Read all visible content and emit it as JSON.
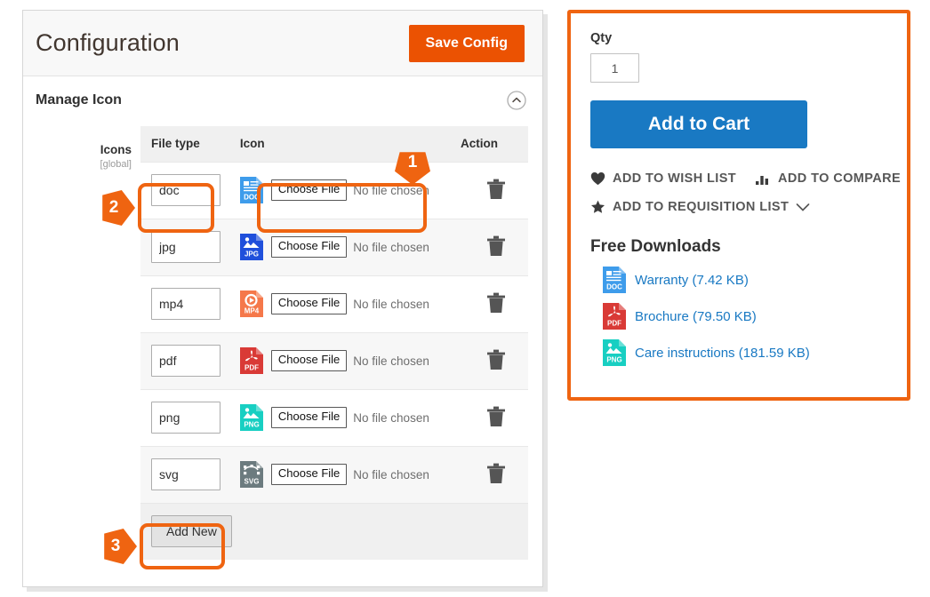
{
  "admin": {
    "page_title": "Configuration",
    "save_label": "Save Config",
    "section_title": "Manage Icon",
    "collapse_icon": "chevron-up-circle-icon",
    "field": {
      "label": "Icons",
      "scope": "[global]"
    },
    "table": {
      "headers": [
        "File type",
        "Icon",
        "",
        "Action"
      ],
      "choose_file_label": "Choose File",
      "no_file_label": "No file chosen",
      "delete_icon": "trash-icon",
      "rows": [
        {
          "file_type": "doc",
          "icon": "doc-file-icon",
          "icon_label": "DOC",
          "icon_color": "#3e9ceb",
          "choose_file": "Choose File",
          "no_file": "No file chosen"
        },
        {
          "file_type": "jpg",
          "icon": "jpg-file-icon",
          "icon_label": "JPG",
          "icon_color": "#1f4fdb",
          "choose_file": "Choose File",
          "no_file": "No file chosen"
        },
        {
          "file_type": "mp4",
          "icon": "mp4-file-icon",
          "icon_label": "MP4",
          "icon_color": "#f5784a",
          "choose_file": "Choose File",
          "no_file": "No file chosen"
        },
        {
          "file_type": "pdf",
          "icon": "pdf-file-icon",
          "icon_label": "PDF",
          "icon_color": "#d93a36",
          "choose_file": "Choose File",
          "no_file": "No file chosen"
        },
        {
          "file_type": "png",
          "icon": "png-file-icon",
          "icon_label": "PNG",
          "icon_color": "#18cfc2",
          "choose_file": "Choose File",
          "no_file": "No file chosen"
        },
        {
          "file_type": "svg",
          "icon": "svg-file-icon",
          "icon_label": "SVG",
          "icon_color": "#6c7b7f",
          "choose_file": "Choose File",
          "no_file": "No file chosen"
        }
      ]
    },
    "add_new_label": "Add New"
  },
  "storefront": {
    "qty_label": "Qty",
    "qty_value": "1",
    "add_to_cart_label": "Add to Cart",
    "wish_list_label": "ADD TO WISH LIST",
    "wish_list_icon": "heart-icon",
    "compare_label": "ADD TO COMPARE",
    "compare_icon": "bar-chart-icon",
    "requisition_label": "ADD TO REQUISITION LIST",
    "requisition_icon": "star-icon",
    "requisition_chevron": "chevron-down-icon",
    "free_downloads_title": "Free Downloads",
    "downloads": [
      {
        "name": "Warranty (7.42 KB)",
        "icon": "doc-file-icon",
        "icon_label": "DOC",
        "icon_color": "#3e9ceb"
      },
      {
        "name": "Brochure (79.50 KB)",
        "icon": "pdf-file-icon",
        "icon_label": "PDF",
        "icon_color": "#d93a36"
      },
      {
        "name": "Care instructions (181.59 KB)",
        "icon": "png-file-icon",
        "icon_label": "PNG",
        "icon_color": "#18cfc2"
      }
    ]
  },
  "annotations": {
    "accent_color": "#ef6411",
    "markers": [
      {
        "number": "1",
        "points": "down",
        "target": "file-upload-cell"
      },
      {
        "number": "2",
        "points": "right",
        "target": "file-type-input"
      },
      {
        "number": "3",
        "points": "right",
        "target": "add-new-button"
      }
    ]
  }
}
